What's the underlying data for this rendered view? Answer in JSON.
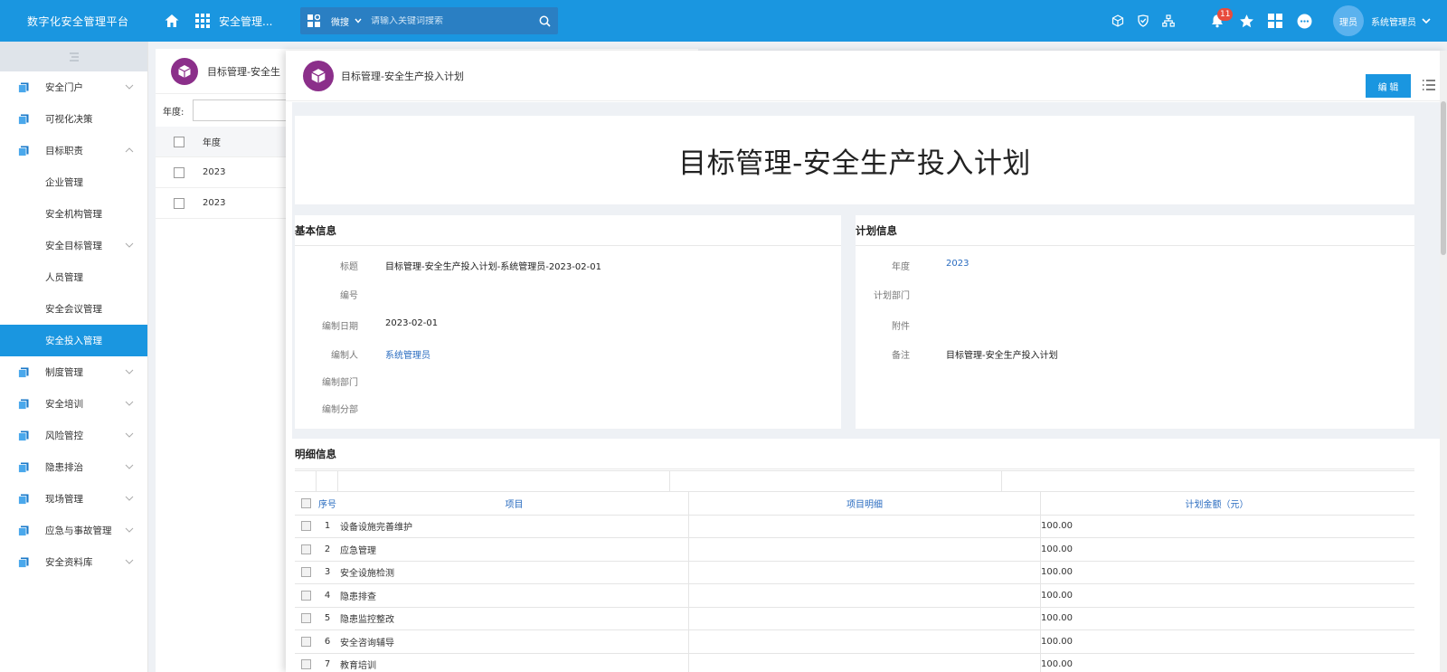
{
  "topbar": {
    "brand": "数字化安全管理平台",
    "app_title": "安全管理...",
    "search_scope": "微搜",
    "search_placeholder": "请输入关键词搜索",
    "notification_count": "11",
    "avatar_text": "理员",
    "username": "系统管理员",
    "icons": [
      "home-icon",
      "apps-grid-icon",
      "search-type-icon",
      "search-icon",
      "cube-icon",
      "shield-icon",
      "org-tree-icon",
      "bell-icon",
      "star-icon",
      "dashboard-icon",
      "chat-icon",
      "chevron-down-icon"
    ]
  },
  "sidebar": {
    "items": [
      {
        "label": "安全门户",
        "type": "group",
        "expandable": true
      },
      {
        "label": "可视化决策",
        "type": "group",
        "expandable": false
      },
      {
        "label": "目标职责",
        "type": "group",
        "expandable": true,
        "expanded": true
      },
      {
        "label": "企业管理",
        "type": "sub"
      },
      {
        "label": "安全机构管理",
        "type": "sub"
      },
      {
        "label": "安全目标管理",
        "type": "sub",
        "expandable": true
      },
      {
        "label": "人员管理",
        "type": "sub"
      },
      {
        "label": "安全会议管理",
        "type": "sub"
      },
      {
        "label": "安全投入管理",
        "type": "sub",
        "active": true
      },
      {
        "label": "制度管理",
        "type": "group",
        "expandable": true
      },
      {
        "label": "安全培训",
        "type": "group",
        "expandable": true
      },
      {
        "label": "风险管控",
        "type": "group",
        "expandable": true
      },
      {
        "label": "隐患排治",
        "type": "group",
        "expandable": true
      },
      {
        "label": "现场管理",
        "type": "group",
        "expandable": true
      },
      {
        "label": "应急与事故管理",
        "type": "group",
        "expandable": true
      },
      {
        "label": "安全资料库",
        "type": "group",
        "expandable": true
      }
    ]
  },
  "list_page": {
    "title": "目标管理-安全生",
    "filter_label": "年度:",
    "columns": [
      "年度"
    ],
    "rows": [
      [
        "2023"
      ],
      [
        "2023"
      ]
    ]
  },
  "detail": {
    "header_title": "目标管理-安全生产投入计划",
    "edit_label": "编 辑",
    "big_title": "目标管理-安全生产投入计划",
    "basic_info": {
      "title": "基本信息",
      "fields": [
        {
          "label": "标题",
          "value": "目标管理-安全生产投入计划-系统管理员-2023-02-01"
        },
        {
          "label": "编号",
          "value": ""
        },
        {
          "label": "编制日期",
          "value": "2023-02-01"
        },
        {
          "label": "编制人",
          "value": "系统管理员"
        },
        {
          "label": "编制部门",
          "value": ""
        },
        {
          "label": "编制分部",
          "value": ""
        }
      ]
    },
    "plan_info": {
      "title": "计划信息",
      "fields": [
        {
          "label": "年度",
          "value": "2023"
        },
        {
          "label": "计划部门",
          "value": ""
        },
        {
          "label": "附件",
          "value": ""
        },
        {
          "label": "备注",
          "value": "目标管理-安全生产投入计划"
        }
      ]
    },
    "detail_info": {
      "title": "明细信息",
      "columns": [
        "序号",
        "项目",
        "项目明细",
        "计划金额（元）"
      ],
      "rows": [
        {
          "no": "1",
          "item": "设备设施完善维护",
          "detail": "",
          "amount": "100.00"
        },
        {
          "no": "2",
          "item": "应急管理",
          "detail": "",
          "amount": "100.00"
        },
        {
          "no": "3",
          "item": "安全设施检测",
          "detail": "",
          "amount": "100.00"
        },
        {
          "no": "4",
          "item": "隐患排查",
          "detail": "",
          "amount": "100.00"
        },
        {
          "no": "5",
          "item": "隐患监控整改",
          "detail": "",
          "amount": "100.00"
        },
        {
          "no": "6",
          "item": "安全咨询辅导",
          "detail": "",
          "amount": "100.00"
        },
        {
          "no": "7",
          "item": "教育培训",
          "detail": "",
          "amount": "100.00"
        }
      ]
    }
  }
}
